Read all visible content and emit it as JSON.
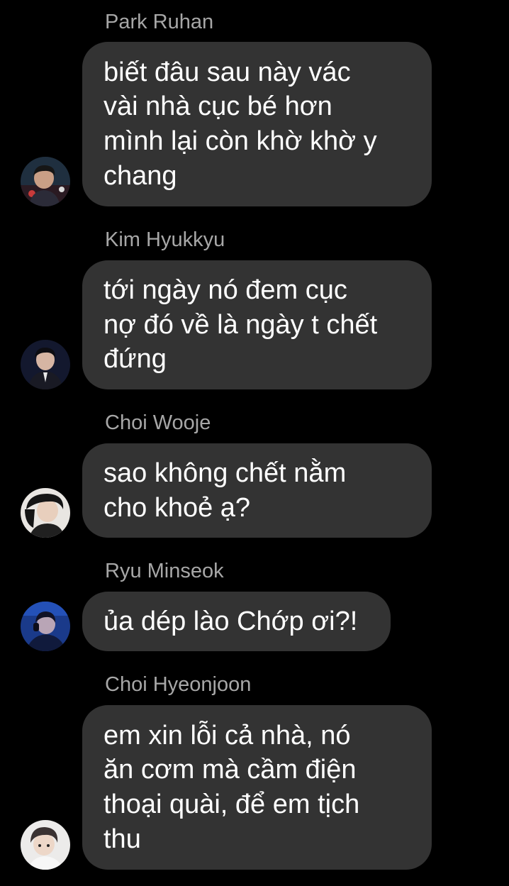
{
  "messages": [
    {
      "sender": "Park Ruhan",
      "text": "biết đâu sau này vác\nvài nhà cục bé hơn\nmình lại còn khờ khờ y\nchang",
      "avatar_icon": "user-avatar-photo"
    },
    {
      "sender": "Kim Hyukkyu",
      "text": "tới ngày nó đem cục\nnợ đó về là ngày t chết\nđứng",
      "avatar_icon": "user-avatar-photo"
    },
    {
      "sender": "Choi Wooje",
      "text": "sao không chết nằm\ncho khoẻ ạ?",
      "avatar_icon": "user-avatar-photo"
    },
    {
      "sender": "Ryu Minseok",
      "text": "ủa dép lào Chớp ơi?!",
      "avatar_icon": "user-avatar-photo"
    },
    {
      "sender": "Choi Hyeonjoon",
      "text": "em xin lỗi cả nhà, nó\năn cơm mà cầm điện\nthoại quài, để em tịch\nthu",
      "avatar_icon": "user-avatar-photo"
    }
  ],
  "colors": {
    "background": "#000000",
    "bubble": "#333333",
    "sender_name": "#a7a7a7",
    "message_text": "#ffffff"
  }
}
